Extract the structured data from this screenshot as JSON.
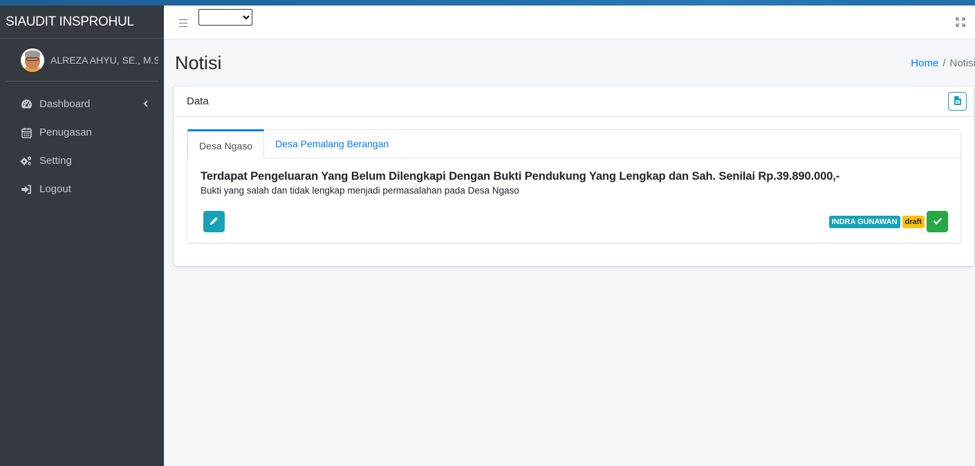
{
  "app": {
    "brand": "SIAUDIT INSPROHUL"
  },
  "user": {
    "name": "ALREZA AHYU, SE., M.Si., M.Si."
  },
  "sidebar": {
    "items": [
      {
        "label": "Dashboard",
        "icon": "dashboard-gauge-icon",
        "has_submenu": true
      },
      {
        "label": "Penugasan",
        "icon": "calendar-icon"
      },
      {
        "label": "Setting",
        "icon": "gears-icon"
      },
      {
        "label": "Logout",
        "icon": "logout-icon"
      }
    ]
  },
  "topbar": {
    "select_value": ""
  },
  "page": {
    "title": "Notisi",
    "breadcrumb": {
      "home": "Home",
      "sep": "/",
      "current": "Notisi"
    }
  },
  "card": {
    "title": "Data"
  },
  "tabs": [
    {
      "label": "Desa Ngaso",
      "active": true
    },
    {
      "label": "Desa Pemalang Berangan",
      "active": false
    }
  ],
  "finding": {
    "title": "Terdapat Pengeluaran Yang Belum Dilengkapi Dengan Bukti Pendukung Yang Lengkap dan Sah. Senilai Rp.39.890.000,-",
    "description": "Bukti yang salah dan tidak lengkap menjadi permasalahan pada Desa Ngaso",
    "auditor": "INDRA GUNAWAN",
    "status": "draft"
  },
  "colors": {
    "sidebar_bg": "#343a40",
    "primary": "#007bff",
    "info": "#17a2b8",
    "warning": "#ffc107",
    "success": "#28a745"
  }
}
